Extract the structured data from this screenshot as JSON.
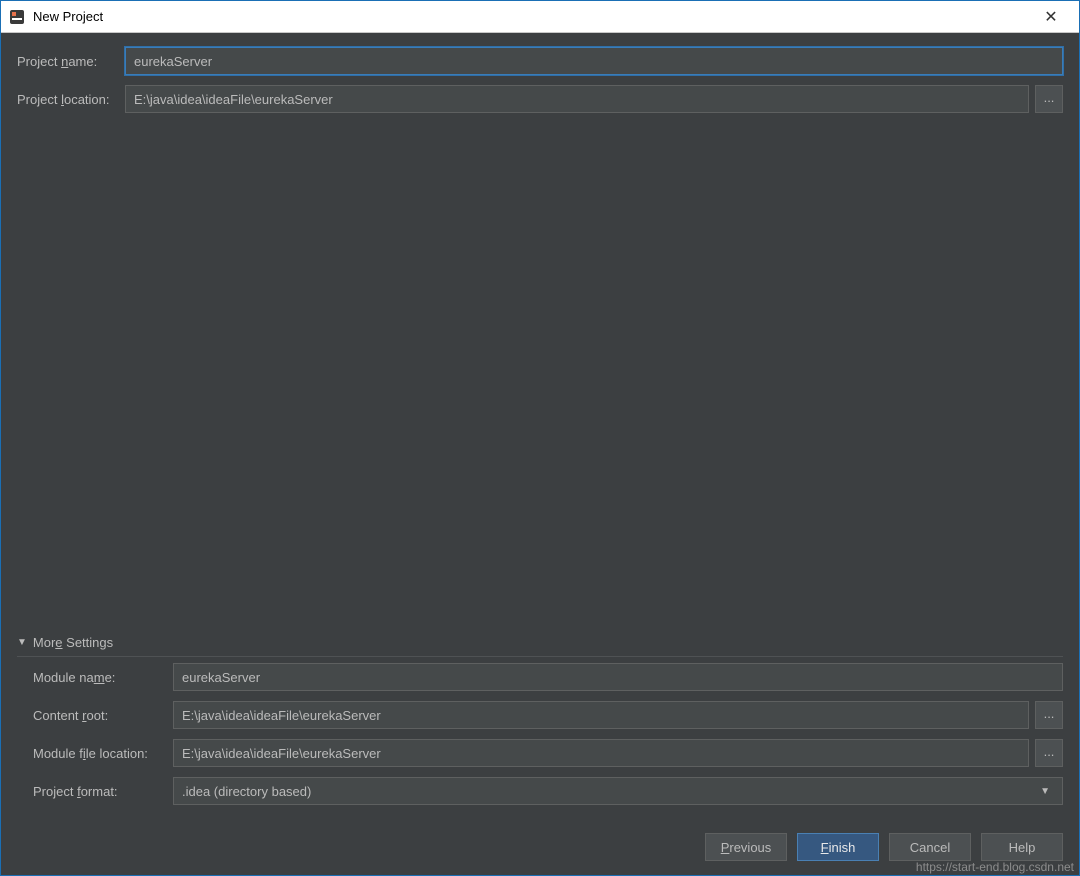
{
  "window": {
    "title": "New Project"
  },
  "form": {
    "project_name_label": "Project name:",
    "project_name_value": "eurekaServer",
    "project_location_label": "Project location:",
    "project_location_value": "E:\\java\\idea\\ideaFile\\eurekaServer",
    "browse_label": "..."
  },
  "more": {
    "header": "More Settings",
    "module_name_label": "Module name:",
    "module_name_value": "eurekaServer",
    "content_root_label": "Content root:",
    "content_root_value": "E:\\java\\idea\\ideaFile\\eurekaServer",
    "module_file_location_label": "Module file location:",
    "module_file_location_value": "E:\\java\\idea\\ideaFile\\eurekaServer",
    "project_format_label": "Project format:",
    "project_format_value": ".idea (directory based)"
  },
  "buttons": {
    "previous": "Previous",
    "finish": "Finish",
    "cancel": "Cancel",
    "help": "Help"
  },
  "watermark": "https://start-end.blog.csdn.net"
}
